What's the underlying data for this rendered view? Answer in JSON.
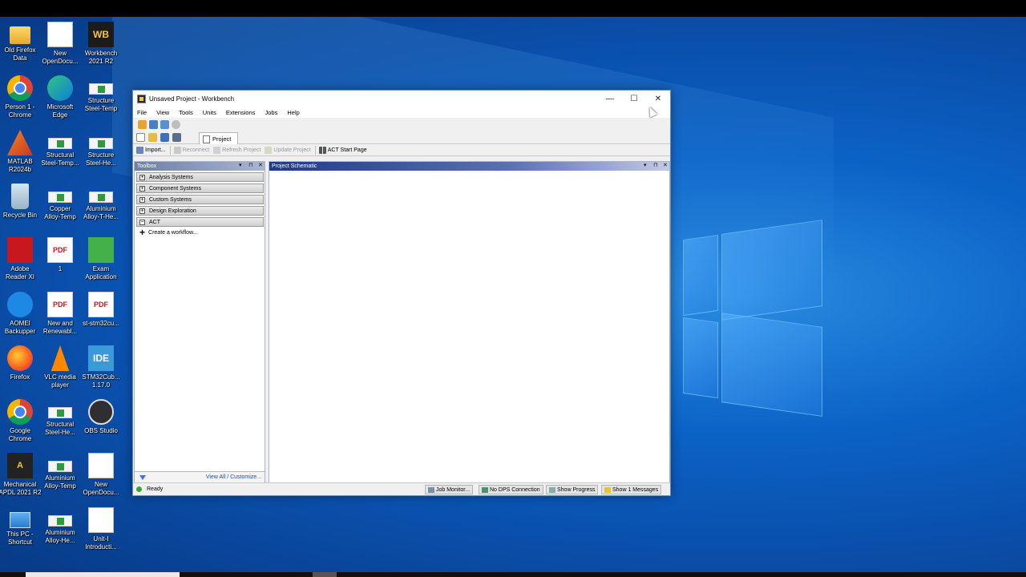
{
  "desktop": {
    "icons": [
      {
        "label": "Old Firefox\nData"
      },
      {
        "label": "New\nOpenDocu..."
      },
      {
        "label": "Workbench\n2021 R2"
      },
      {
        "label": "Person 1 -\nChrome"
      },
      {
        "label": "Microsoft\nEdge"
      },
      {
        "label": "Structure\nSteel-Temp"
      },
      {
        "label": "MATLAB\nR2024b"
      },
      {
        "label": "Structural\nSteel-Temp..."
      },
      {
        "label": "Structure\nSteel-He..."
      },
      {
        "label": "Recycle Bin"
      },
      {
        "label": "Copper\nAlloy-Temp"
      },
      {
        "label": "Aluminium\nAlloy-T-He..."
      },
      {
        "label": "Adobe\nReader XI"
      },
      {
        "label": "1"
      },
      {
        "label": "Exam\nApplication"
      },
      {
        "label": "AOMEI\nBackupper"
      },
      {
        "label": "New and\nRenewabl..."
      },
      {
        "label": "st-stm32cu..."
      },
      {
        "label": "Firefox"
      },
      {
        "label": "VLC media\nplayer"
      },
      {
        "label": "STM32Cub...\n1.17.0"
      },
      {
        "label": "Google\nChrome"
      },
      {
        "label": "Structural\nSteel-He..."
      },
      {
        "label": "OBS Studio"
      },
      {
        "label": "Mechanical\nAPDL 2021 R2"
      },
      {
        "label": "Aluminium\nAlloy-Temp"
      },
      {
        "label": "New\nOpenDocu..."
      },
      {
        "label": "This PC -\nShortcut"
      },
      {
        "label": "Aluminium\nAlloy-He..."
      },
      {
        "label": "Unit-I\nIntroducti..."
      }
    ],
    "icon_glyphs": {
      "workbench": "WB",
      "ide": "IDE",
      "pdf": "PDF",
      "mechanical": "A"
    }
  },
  "window": {
    "title": "Unsaved Project - Workbench",
    "minimize": "—",
    "maximize": "☐",
    "close": "✕",
    "menu": [
      "File",
      "View",
      "Tools",
      "Units",
      "Extensions",
      "Jobs",
      "Help"
    ],
    "tab_project": "Project",
    "toolbar": {
      "import": "Import...",
      "reconnect": "Reconnect",
      "refresh": "Refresh Project",
      "update": "Update Project",
      "act_start": "ACT Start Page"
    },
    "toolbox": {
      "title": "Toolbox",
      "categories": [
        "Analysis Systems",
        "Component Systems",
        "Custom Systems",
        "Design Exploration",
        "ACT"
      ],
      "expander_collapsed": "+",
      "expander_expanded": "−",
      "create_workflow": "Create a workflow...",
      "create_symbol": "+",
      "view_all": "View All / Customize..."
    },
    "schematic": {
      "title": "Project Schematic"
    },
    "pane_controls": {
      "dropdown": "▾",
      "pin": "⊓",
      "close": "✕"
    },
    "status": {
      "ready": "Ready",
      "job_monitor": "Job Monitor...",
      "dps": "No DPS Connection",
      "progress": "Show Progress",
      "messages": "Show 1 Messages"
    }
  },
  "colors": {
    "desktop_blue": "#0b63c7",
    "schematic_header": "#1f3a8a",
    "toolbox_header": "#6c7fa6",
    "steel_green": "#2e9b3a",
    "pdf_red": "#c8171f"
  }
}
